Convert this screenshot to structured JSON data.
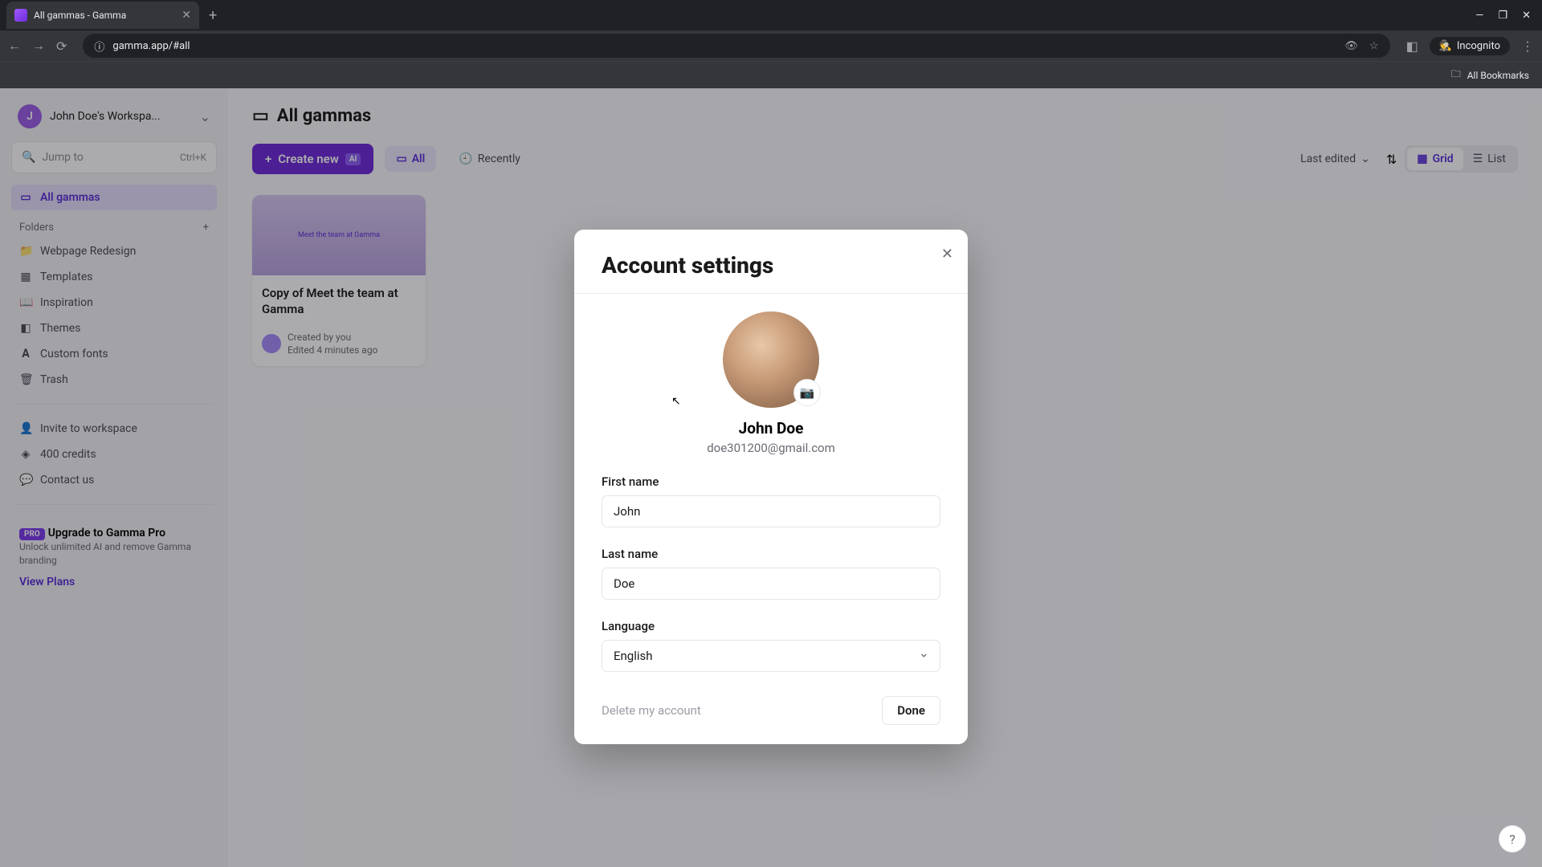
{
  "browser": {
    "tab_title": "All gammas - Gamma",
    "url": "gamma.app/#all",
    "incognito": "Incognito",
    "bookmarks": "All Bookmarks"
  },
  "sidebar": {
    "workspace_initial": "J",
    "workspace_name": "John Doe's Workspa...",
    "jump_placeholder": "Jump to",
    "jump_kbd": "Ctrl+K",
    "all_gammas": "All gammas",
    "folders_label": "Folders",
    "items": [
      {
        "icon": "📁",
        "label": "Webpage Redesign"
      },
      {
        "icon": "▦",
        "label": "Templates"
      },
      {
        "icon": "📖",
        "label": "Inspiration"
      },
      {
        "icon": "◧",
        "label": "Themes"
      },
      {
        "icon": "𝐀",
        "label": "Custom fonts"
      },
      {
        "icon": "🗑",
        "label": "Trash"
      }
    ],
    "extras": [
      {
        "icon": "👤",
        "label": "Invite to workspace"
      },
      {
        "icon": "◈",
        "label": "400 credits"
      },
      {
        "icon": "💬",
        "label": "Contact us"
      }
    ],
    "promo": {
      "badge": "PRO",
      "title": "Upgrade to Gamma Pro",
      "desc": "Unlock unlimited AI and remove Gamma branding",
      "cta": "View Plans"
    }
  },
  "main": {
    "title": "All gammas",
    "create": "Create new",
    "ai": "AI",
    "tabs": [
      {
        "label": "All",
        "icon": "▭"
      },
      {
        "label": "Recently",
        "icon": "🕘"
      }
    ],
    "sort": "Last edited",
    "views": {
      "grid": "Grid",
      "list": "List"
    },
    "card": {
      "thumb_text": "Meet the team at Gamma",
      "title": "Copy of Meet the team at Gamma",
      "created": "Created by you",
      "edited": "Edited 4 minutes ago"
    }
  },
  "modal": {
    "title": "Account settings",
    "user_name": "John Doe",
    "user_email": "doe301200@gmail.com",
    "first_name_label": "First name",
    "first_name_value": "John",
    "last_name_label": "Last name",
    "last_name_value": "Doe",
    "language_label": "Language",
    "language_value": "English",
    "delete": "Delete my account",
    "done": "Done"
  }
}
